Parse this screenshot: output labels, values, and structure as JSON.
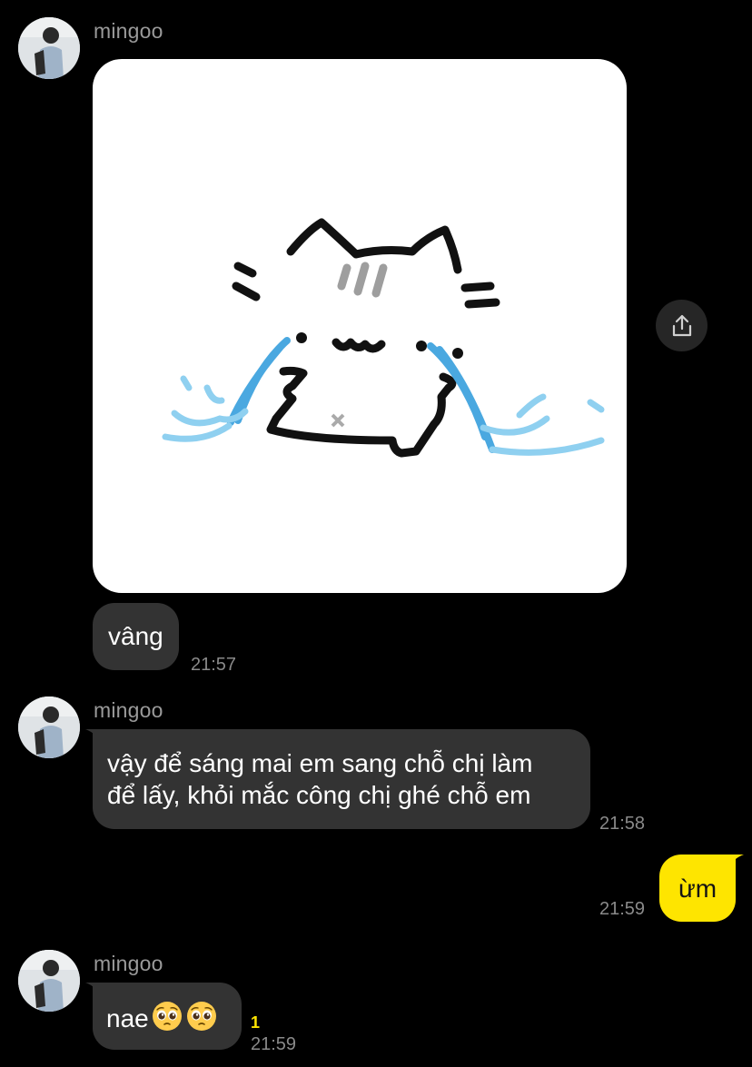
{
  "messages": {
    "group1": {
      "sender": "mingoo",
      "text": "vâng",
      "time": "21:57"
    },
    "group2": {
      "sender": "mingoo",
      "line1": "vậy để sáng mai em sang chỗ chị làm",
      "line2": "để lấy, khỏi mắc công chị ghé chỗ em",
      "time": "21:58"
    },
    "group3": {
      "text": "ừm",
      "time": "21:59"
    },
    "group4": {
      "sender": "mingoo",
      "text": "nae",
      "emoji_1": "pleading-face-icon",
      "emoji_2": "pleading-face-icon",
      "unread_count": "1",
      "time": "21:59"
    }
  },
  "icons": {
    "share": "share-icon",
    "avatar": "avatar",
    "sticker": "crying-cat-sticker"
  },
  "colors": {
    "background": "#000000",
    "incoming_bubble": "#333333",
    "outgoing_bubble": "#fee500",
    "unread": "#fee500"
  }
}
